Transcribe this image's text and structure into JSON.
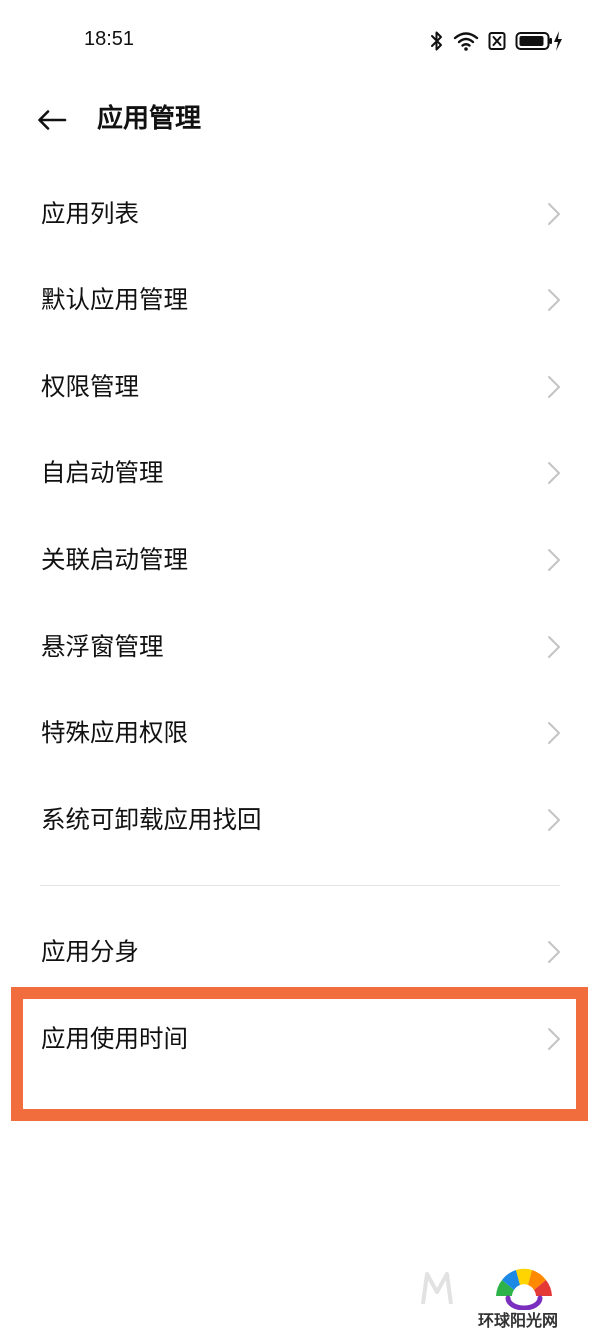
{
  "status_bar": {
    "time": "18:51",
    "icons": [
      "bluetooth-icon",
      "wifi-icon",
      "sim-off-icon",
      "battery-charging-icon"
    ]
  },
  "header": {
    "back_icon": "arrow-left-icon",
    "title": "应用管理"
  },
  "menu": {
    "items": [
      {
        "label": "应用列表"
      },
      {
        "label": "默认应用管理"
      },
      {
        "label": "权限管理"
      },
      {
        "label": "自启动管理"
      },
      {
        "label": "关联启动管理"
      },
      {
        "label": "悬浮窗管理"
      },
      {
        "label": "特殊应用权限"
      },
      {
        "label": "系统可卸载应用找回"
      },
      {
        "label": "应用分身"
      },
      {
        "label": "应用使用时间"
      }
    ]
  },
  "highlight": {
    "color": "#f26d3d",
    "target_label": "应用使用时间"
  },
  "watermark": {
    "mark": "M",
    "text": "环球阳光网"
  }
}
